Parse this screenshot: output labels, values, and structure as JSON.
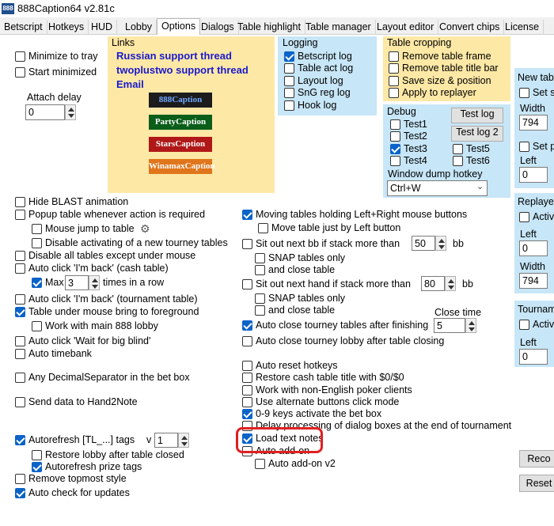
{
  "window": {
    "title": "888Caption64 v2.81c",
    "app_icon": "app-logo-icon"
  },
  "tabs": [
    "Betscript",
    "Hotkeys",
    "HUD",
    "Lobby",
    "Options",
    "Dialogs",
    "Table highlight",
    "Table manager",
    "Layout editor",
    "Convert chips",
    "License"
  ],
  "active_tab": "Options",
  "colors": {
    "links_bg": "#fde8a6",
    "logging_bg": "#c7e6f7",
    "cropping_bg": "#fde8a6",
    "debug_bg": "#c7e6f7",
    "accent": "#0a63c8",
    "highlight": "#e02020"
  },
  "left": {
    "minimize_to_tray": "Minimize to tray",
    "start_minimized": "Start minimized",
    "attach_delay_label": "Attach delay",
    "attach_delay_value": "0",
    "hide_blast": "Hide BLAST animation",
    "popup_table": "Popup table whenever action is required",
    "mouse_jump": "Mouse jump to table",
    "disable_activating": "Disable activating of a new tourney tables",
    "disable_all_tables": "Disable all tables except under mouse",
    "auto_click_cash": "Auto click 'I'm back' (cash table)",
    "max_label": "Max",
    "max_value": "3",
    "times_in_row": "times in a row",
    "auto_click_tourn": "Auto click 'I'm back' (tournament table)",
    "table_under_mouse": "Table under mouse bring to foreground",
    "work_with_888": "Work with main 888 lobby",
    "auto_click_bb": "Auto click 'Wait for big blind'",
    "auto_timebank": "Auto timebank",
    "decimal_sep": "Any DecimalSeparator in the bet box",
    "send_h2n": "Send data to Hand2Note",
    "autorefresh_tags": "Autorefresh [TL_...] tags",
    "v_label": "v",
    "v_value": "1",
    "restore_lobby": "Restore lobby after table closed",
    "autorefresh_prize": "Autorefresh prize tags",
    "remove_topmost": "Remove topmost style",
    "auto_check_updates": "Auto check for updates"
  },
  "links": {
    "header": "Links",
    "russian": "Russian support thread",
    "twoplustwo": "twoplustwo support thread",
    "email": "Email",
    "banners": [
      "888Caption",
      "PartyCaption",
      "StarsCaption",
      "WinamaxCaption"
    ]
  },
  "logging": {
    "header": "Logging",
    "items": [
      "Betscript log",
      "Table act log",
      "Layout log",
      "SnG reg log",
      "Hook log"
    ]
  },
  "cropping": {
    "header": "Table cropping",
    "items": [
      "Remove table frame",
      "Remove table title bar",
      "Save size & position",
      "Apply to replayer"
    ]
  },
  "debug": {
    "header": "Debug",
    "tests": [
      "Test1",
      "Test2",
      "Test3",
      "Test4",
      "Test5",
      "Test6"
    ],
    "test_log_btn": "Test log",
    "test_log2_btn": "Test log 2",
    "hotkey_label": "Window dump hotkey",
    "hotkey_value": "Ctrl+W"
  },
  "middle": {
    "moving_tables": "Moving tables holding Left+Right mouse buttons",
    "move_left": "Move table just by Left button",
    "sit_out_bb": "Sit out next bb if stack more than",
    "sit_out_bb_value": "50",
    "bb_unit": "bb",
    "snap_only_1": "SNAP tables only",
    "close_table_1": "and close table",
    "sit_out_hand": "Sit out next hand if stack more than",
    "sit_out_hand_value": "80",
    "snap_only_2": "SNAP tables only",
    "close_table_2": "and close table",
    "close_time_label": "Close time",
    "close_time_value": "5",
    "auto_close_tourney": "Auto close tourney tables after finishing",
    "auto_close_lobby": "Auto close tourney lobby after table closing",
    "auto_reset": "Auto reset hotkeys",
    "restore_cash": "Restore cash table title with $0/$0",
    "non_english": "Work with non-English poker clients",
    "alt_buttons": "Use alternate buttons click mode",
    "keys_09": "0-9 keys activate the bet box",
    "delay_dialogs": "Delay processing of dialog boxes at the end of tournament",
    "load_notes": "Load text notes",
    "auto_addon": "Auto add-on",
    "auto_addon_v2": "Auto add-on v2"
  },
  "right": {
    "new_table": "New tabl",
    "set_s": "Set s",
    "width_label": "Width",
    "width_value": "794",
    "set_p": "Set p",
    "left_label": "Left",
    "left_value": "0",
    "replayer": "Replayer",
    "activ": "Activ",
    "replayer_left_label": "Left",
    "replayer_left_value": "0",
    "replayer_width_label": "Width",
    "replayer_width_value": "794",
    "tournam": "Tournam",
    "active": "Active",
    "tourn_left_label": "Left",
    "tourn_left_value": "0",
    "reco_btn": "Reco",
    "reset_btn": "Reset"
  }
}
